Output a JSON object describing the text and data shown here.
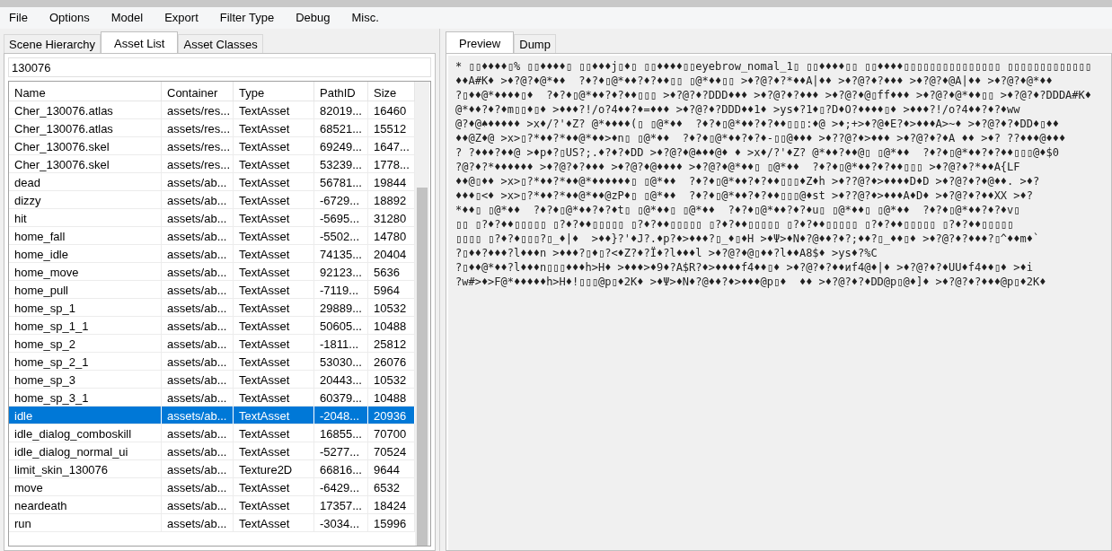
{
  "menu": [
    "File",
    "Options",
    "Model",
    "Export",
    "Filter Type",
    "Debug",
    "Misc."
  ],
  "left_tabs": [
    {
      "label": "Scene Hierarchy",
      "selected": false
    },
    {
      "label": "Asset List",
      "selected": true
    },
    {
      "label": "Asset Classes",
      "selected": false
    }
  ],
  "filter": {
    "value": "130076"
  },
  "table": {
    "columns": [
      "Name",
      "Container",
      "Type",
      "PathID",
      "Size"
    ],
    "rows": [
      {
        "cells": [
          "Cher_130076.atlas",
          "assets/res...",
          "TextAsset",
          "82019...",
          "16460"
        ],
        "selected": false
      },
      {
        "cells": [
          "Cher_130076.atlas",
          "assets/res...",
          "TextAsset",
          "68521...",
          "15512"
        ],
        "selected": false
      },
      {
        "cells": [
          "Cher_130076.skel",
          "assets/res...",
          "TextAsset",
          "69249...",
          "1647..."
        ],
        "selected": false
      },
      {
        "cells": [
          "Cher_130076.skel",
          "assets/res...",
          "TextAsset",
          "53239...",
          "1778..."
        ],
        "selected": false
      },
      {
        "cells": [
          "dead",
          "assets/ab...",
          "TextAsset",
          "56781...",
          "19844"
        ],
        "selected": false
      },
      {
        "cells": [
          "dizzy",
          "assets/ab...",
          "TextAsset",
          "-6729...",
          "18892"
        ],
        "selected": false
      },
      {
        "cells": [
          "hit",
          "assets/ab...",
          "TextAsset",
          "-5695...",
          "31280"
        ],
        "selected": false
      },
      {
        "cells": [
          "home_fall",
          "assets/ab...",
          "TextAsset",
          "-5502...",
          "14780"
        ],
        "selected": false
      },
      {
        "cells": [
          "home_idle",
          "assets/ab...",
          "TextAsset",
          "74135...",
          "20404"
        ],
        "selected": false
      },
      {
        "cells": [
          "home_move",
          "assets/ab...",
          "TextAsset",
          "92123...",
          "5636"
        ],
        "selected": false
      },
      {
        "cells": [
          "home_pull",
          "assets/ab...",
          "TextAsset",
          "-7119...",
          "5964"
        ],
        "selected": false
      },
      {
        "cells": [
          "home_sp_1",
          "assets/ab...",
          "TextAsset",
          "29889...",
          "10532"
        ],
        "selected": false
      },
      {
        "cells": [
          "home_sp_1_1",
          "assets/ab...",
          "TextAsset",
          "50605...",
          "10488"
        ],
        "selected": false
      },
      {
        "cells": [
          "home_sp_2",
          "assets/ab...",
          "TextAsset",
          "-1811...",
          "25812"
        ],
        "selected": false
      },
      {
        "cells": [
          "home_sp_2_1",
          "assets/ab...",
          "TextAsset",
          "53030...",
          "26076"
        ],
        "selected": false
      },
      {
        "cells": [
          "home_sp_3",
          "assets/ab...",
          "TextAsset",
          "20443...",
          "10532"
        ],
        "selected": false
      },
      {
        "cells": [
          "home_sp_3_1",
          "assets/ab...",
          "TextAsset",
          "60379...",
          "10488"
        ],
        "selected": false
      },
      {
        "cells": [
          "idle",
          "assets/ab...",
          "TextAsset",
          "-2048...",
          "20936"
        ],
        "selected": true
      },
      {
        "cells": [
          "idle_dialog_comboskill",
          "assets/ab...",
          "TextAsset",
          "16855...",
          "70700"
        ],
        "selected": false
      },
      {
        "cells": [
          "idle_dialog_normal_ui",
          "assets/ab...",
          "TextAsset",
          "-5277...",
          "70524"
        ],
        "selected": false
      },
      {
        "cells": [
          "limit_skin_130076",
          "assets/ab...",
          "Texture2D",
          "66816...",
          "9644"
        ],
        "selected": false
      },
      {
        "cells": [
          "move",
          "assets/ab...",
          "TextAsset",
          "-6429...",
          "6532"
        ],
        "selected": false
      },
      {
        "cells": [
          "neardeath",
          "assets/ab...",
          "TextAsset",
          "17357...",
          "18424"
        ],
        "selected": false
      },
      {
        "cells": [
          "run",
          "assets/ab...",
          "TextAsset",
          "-3034...",
          "15996"
        ],
        "selected": false
      }
    ]
  },
  "right_tabs": [
    {
      "label": "Preview",
      "selected": true
    },
    {
      "label": "Dump",
      "selected": false
    }
  ],
  "preview_lines": [
    "* ▯▯♦♦♦♦▯% ▯▯♦♦♦♦▯ ▯▯♦♦♦j▯♦▯ ▯▯♦♦♦♦▯▯eyebrow_nomal_1▯ ▯▯♦♦♦♦▯▯ ▯▯♦♦♦♦▯▯▯▯▯▯▯▯▯▯▯▯▯▯▯ ▯▯▯▯▯▯▯▯▯▯▯▯▯",
    "♦♦A#K♦ >♦?@?♦@*♦♦  ?♦?♦▯@*♦♦?♦?♦♦▯▯ ▯@*♦♦▯▯ >♦?@?♦?*♦♦A|♦♦ >♦?@?♦?♦♦♦ >♦?@?♦@A|♦♦ >♦?@?♦@*♦♦",
    "?▯♦♦@*♦♦♦♦▯♦  ?♦?♦▯@*♦♦?♦?♦♦▯▯▯ >♦?@?♦?DDD♦♦♦ >♦?@?♦?♦♦♦ >♦?@?♦@▯ff♦♦♦ >♦?@?♦@*♦♦▯▯ >♦?@?♦?DDDA#K♦",
    "@*♦♦?♦?♦m▯▯♦▯♦ >♦♦♦?!/o?4♦♦?♦=♦♦♦ >♦?@?♦?DDD♦♦1♦ >ys♦?1♦▯?D♦O?♦♦♦♦▯♦ >♦♦♦?!/o?4♦♦?♦?♦ww",
    "@?♦@♠♦♦♦♦♦ >x♦/?'♦Z? @*♦♦♦♦(▯ ▯@*♦♦  ?♦?♦▯@*♦♦?♦?♦♦▯▯▯:♦@ >♦;+>♦?@♦E?♦>♦♦♦A>~♦ >♦?@?♦?♦DD♦▯♦♦",
    "♦♦@Z♦@ >x>▯?*♦♦?*♦♦@*♦♦>♦n▯ ▯@*♦♦  ?♦?♦▯@*♦♦?♦?♦-▯▯@♦♦♦ >♦??@?♦>♦♦♦ >♦?@?♦?♦A ♦♦ >♦? ??♦♦♦@♦♦♦",
    "? ?♦♦♦?♦♦@ >♦p♦?▯US?;.♦?♦?♦DD >♦?@?♦@♠♦♦@♦ ♦ >x♦/?'♦Z? @*♦♦?♦♦@▯ ▯@*♦♦  ?♦?♦▯@*♦♦?♦?♦♦▯▯▯@♦$0",
    "?@?♦?*♦♦♦♦♦♦ >♦?@?♦?♦♦♦ >♦?@?♦@♦♦♦♦ >♦?@?♦@*♦♦▯ ▯@*♦♦  ?♦?♦▯@*♦♦?♦?♦♦▯▯▯ >♦?@?♦?*♦♦A{LF",
    "♦♦@▯♦♦ >x>▯?*♦♦?*♦♦@*♦♦♦♦♦♦▯ ▯@*♦♦  ?♦?♦▯@*♦♦?♦?♦♦▯▯▯♦Z♦h >♦??@?♦>♦♦♦♦D♦D >♦?@?♦?♦@♦♦. >♦?",
    "♦♦♦▯<♦ >x>▯?*♦♦?*♦♦@*♦♦@zP♦▯ ▯@*♦♦  ?♦?♦▯@*♦♦?♦?♦♦▯▯▯@♦st >♦??@?♦>♦♦♦A♦D♦ >♦?@?♦?♦♦XX >♦?",
    "*♦♦▯ ▯@*♦♦  ?♦?♦▯@*♦♦?♦?♦t▯ ▯@*♦♦▯ ▯@*♦♦  ?♦?♦▯@*♦♦?♦?♦u▯ ▯@*♦♦▯ ▯@*♦♦  ?♦?♦▯@*♦♦?♦?♦v▯",
    "▯▯ ▯?♦?♦♦▯▯▯▯▯ ▯?♦?♦♦▯▯▯▯▯ ▯?♦?♦♦▯▯▯▯▯ ▯?♦?♦♦▯▯▯▯▯ ▯?♦?♦♦▯▯▯▯▯ ▯?♦?♦♦▯▯▯▯▯ ▯?♦?♦♦▯▯▯▯▯",
    "▯▯▯▯ ▯?♦?♦▯▯▯?▯_♦|♦  >♦♦}?'♦J?.♦p?♦>♦♦♦?▯_♦▯♦H >♦Ψ>♦N♦?@♦♦?♦?;♦♦?▯_♦♦▯♦ >♦?@?♦?♦♦♦?▯^♦♦m♦`",
    "?▯♦♦?♦♦♦?l♦♦♦n >♦♦♦?▯♦▯?<♦Z?♦?Ï♦?l♦♦♦l >♦?@?♦@▯♦♦?l♦♦A8$♦ >ys♦?%C",
    "?▯♦♦@*♦♦?l♦♦♦n▯▯▯♦♦♦h>H♦ >♦♦♦>♦9♦?A$R?♦>♦♦♦♦f4♦♦▯♦ >♦?@?♦?♦♦иf4@♦|♦ >♦?@?♦?♦UU♦f4♦♦▯♦ >♦i",
    "?w#>♦>F@*♦♦♦♦♦h>H♦!▯▯▯@p▯♦2K♦ >♦Ψ>♦N♦?@♦♦?♦>♦♦♦@p▯♦  ♦♦ >♦?@?♦?♦DD@p▯@♦]♦ >♦?@?♦?♦♦♦@p▯♦2K♦"
  ]
}
